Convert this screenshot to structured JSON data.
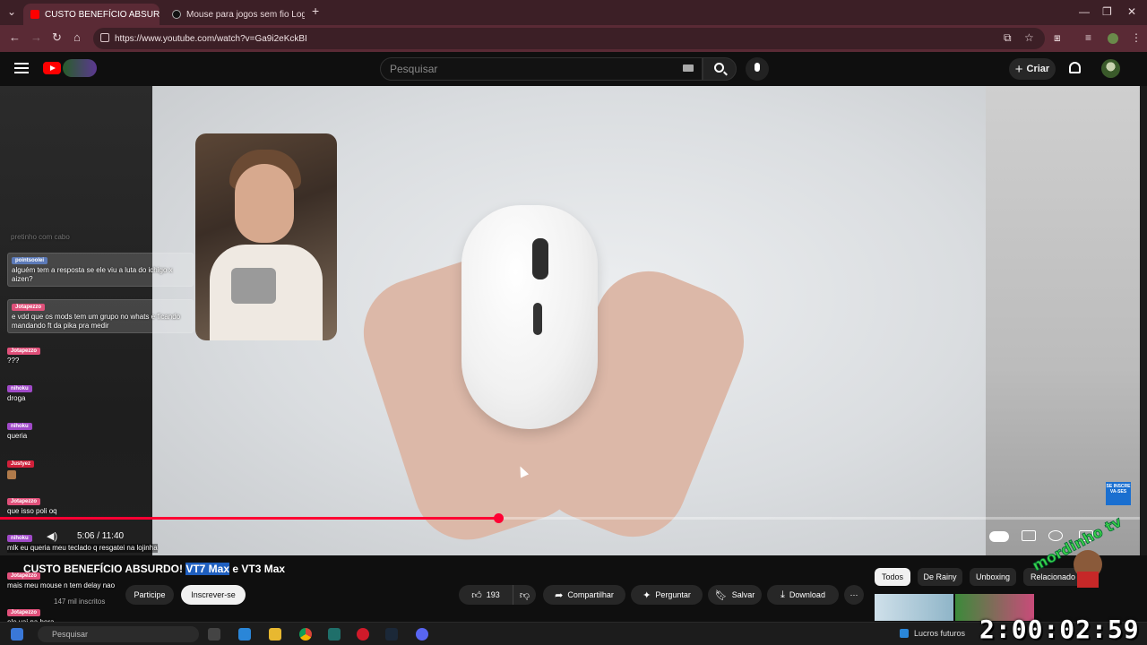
{
  "browser": {
    "tabs": [
      {
        "title": "CUSTO BENEFÍCIO ABSURD",
        "active": true
      },
      {
        "title": "Mouse para jogos sem fio Logi",
        "active": false
      }
    ],
    "url": "https://www.youtube.com/watch?v=Ga9i2eKckBI",
    "new_tab": "+"
  },
  "youtube": {
    "search_placeholder": "Pesquisar",
    "create_label": "Criar"
  },
  "player": {
    "time": "5:06 / 11:40",
    "progress_fraction": 0.437,
    "subscribe_badge": "SE INSCRE VA-SES"
  },
  "chat": [
    {
      "name": "",
      "msg": "pretinho com cabo",
      "color": "#555555"
    },
    {
      "name": "pointsoolei",
      "msg": "alguém tem a resposta se ele viu a luta do ichigo x aizen?",
      "color": "#5c7ab8"
    },
    {
      "name": "Jotapezzo",
      "msg": "e vdd que os mods tem um grupo no whats e ficando mandando ft da pika pra medir",
      "color": "#e0507a"
    },
    {
      "name": "Jotapezzo",
      "msg": "???",
      "color": "#e0507a"
    },
    {
      "name": "nihoku",
      "msg": "droga",
      "color": "#a04ac8"
    },
    {
      "name": "nihoku",
      "msg": "queria",
      "color": "#a04ac8"
    },
    {
      "name": "Justyez",
      "msg": "",
      "color": "#d0203a"
    },
    {
      "name": "Jotapezzo",
      "msg": "que isso poli oq",
      "color": "#e0507a"
    },
    {
      "name": "nihoku",
      "msg": "mlk eu queria meu teclado q resgatei na lojinha",
      "color": "#a04ac8"
    },
    {
      "name": "Jotapezzo",
      "msg": "mais meu mouse n tem delay nao",
      "color": "#e0507a"
    },
    {
      "name": "Jotapezzo",
      "msg": "ele vai na hora",
      "color": "#e0507a"
    }
  ],
  "video": {
    "title_part1": "CUSTO BENEFÍCIO ABSURDO! ",
    "title_highlight": "VT7 Max",
    "title_part2": " e VT3 Max",
    "subscribers": "147 mil inscritos",
    "join_label": "Participe",
    "subscribe_label": "Inscrever-se",
    "likes": "193",
    "share_label": "Compartilhar",
    "ask_label": "Perguntar",
    "save_label": "Salvar",
    "download_label": "Download",
    "more_label": "⋯"
  },
  "chips": [
    "Todos",
    "De Rainy",
    "Unboxing",
    "Relacionado"
  ],
  "taskbar": {
    "search_placeholder": "Pesquisar",
    "news": "Lucros futuros"
  },
  "overlay_clock": "2:00:02:59",
  "watermark_text": "mordinho tv"
}
